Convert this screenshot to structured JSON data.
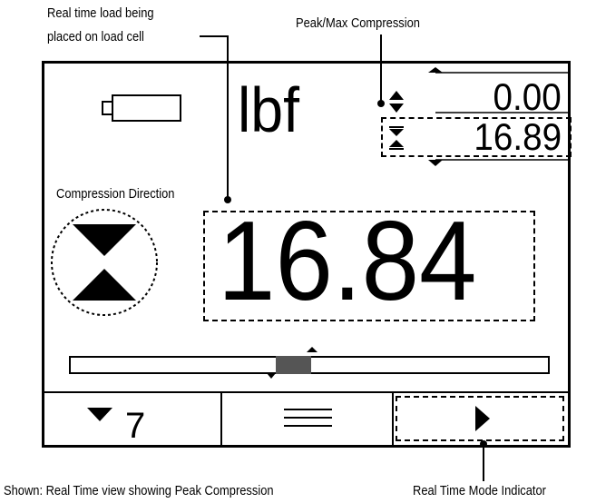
{
  "annotations": {
    "realtime_load_line1": "Real time load being",
    "realtime_load_line2": "placed on load cell",
    "peak_max": "Peak/Max Compression",
    "direction": "Compression Direction",
    "shown": "Shown: Real Time view showing Peak Compression",
    "mode_indicator": "Real Time Mode Indicator"
  },
  "display": {
    "unit": "lbf",
    "peak_tension_value": "0.00",
    "peak_compression_value": "16.89",
    "realtime_value": "16.84",
    "menu_button_number": "7"
  },
  "icons": {
    "battery": "battery-icon",
    "direction": "compression-direction-icon",
    "menu": "menu-icon",
    "play": "play-icon"
  }
}
